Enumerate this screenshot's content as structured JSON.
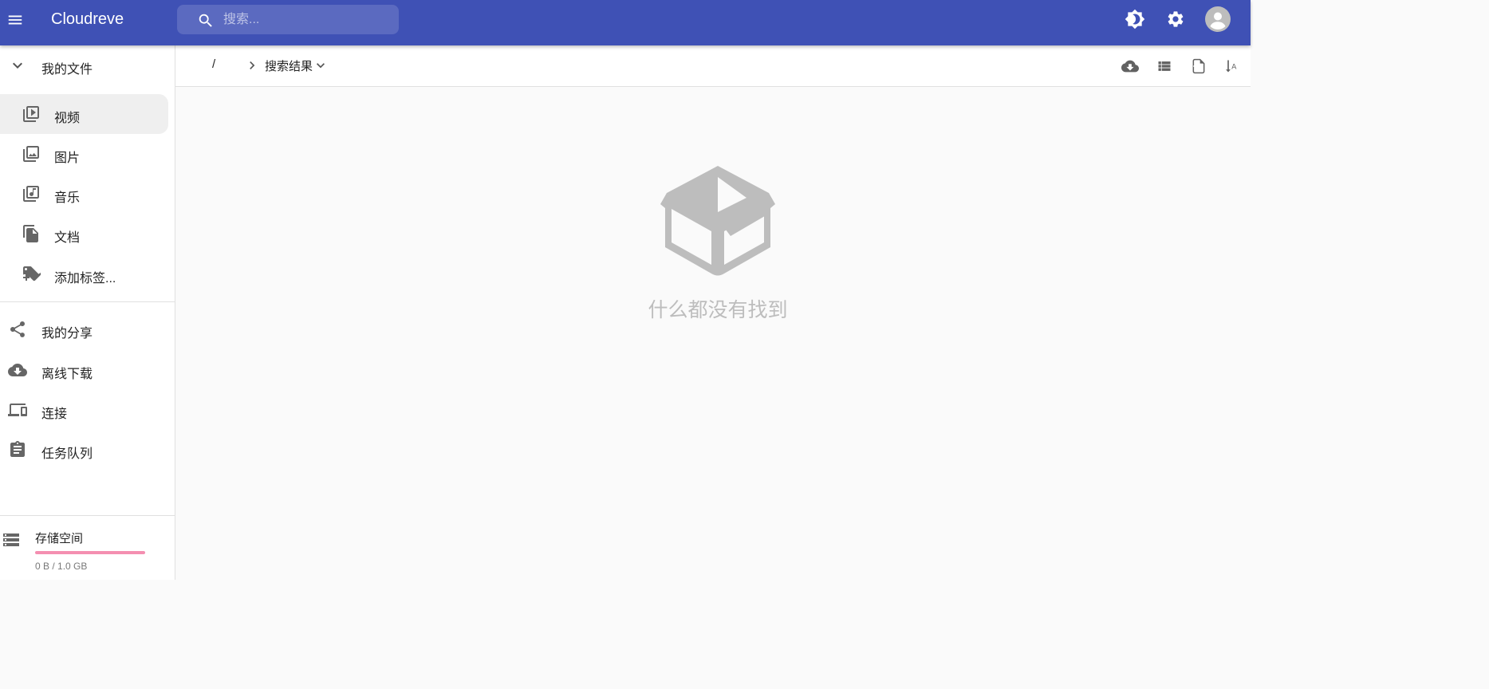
{
  "app": {
    "title": "Cloudreve"
  },
  "search": {
    "placeholder": "搜索..."
  },
  "sidebar": {
    "my_files": "我的文件",
    "categories": [
      {
        "label": "视频",
        "icon": "video-library-icon",
        "selected": true
      },
      {
        "label": "图片",
        "icon": "photo-library-icon",
        "selected": false
      },
      {
        "label": "音乐",
        "icon": "library-music-icon",
        "selected": false
      },
      {
        "label": "文档",
        "icon": "file-copy-icon",
        "selected": false
      },
      {
        "label": "添加标签...",
        "icon": "tag-add-icon",
        "selected": false
      }
    ],
    "nav": [
      {
        "label": "我的分享",
        "icon": "share-icon"
      },
      {
        "label": "离线下载",
        "icon": "cloud-download-icon"
      },
      {
        "label": "连接",
        "icon": "devices-icon"
      },
      {
        "label": "任务队列",
        "icon": "assignment-icon"
      }
    ],
    "storage": {
      "title": "存储空间",
      "usage": "0 B / 1.0 GB",
      "used_fraction": 0
    }
  },
  "breadcrumb": {
    "root": "/",
    "current": "搜索结果"
  },
  "empty": {
    "message": "什么都没有找到"
  },
  "colors": {
    "primary": "#3f51b5",
    "storage_track": "#f48fb1",
    "empty_icon": "#bdbdbd"
  }
}
